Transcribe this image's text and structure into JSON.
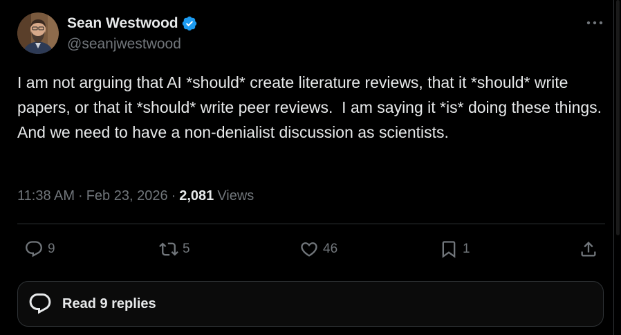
{
  "author": {
    "display_name": "Sean Westwood",
    "handle": "@seanjwestwood",
    "verified": true,
    "verified_color": "#1d9bf0",
    "avatar_icon": "profile-photo"
  },
  "post": {
    "text": "I am not arguing that AI *should* create literature reviews, that it *should* write papers, or that it *should* write peer reviews.  I am saying it *is* doing these things.  And we need to have a non-denialist discussion as scientists.",
    "time": "11:38 AM",
    "date": "Feb 23, 2026",
    "views_count": "2,081",
    "views_label": "Views"
  },
  "actions": {
    "reply": {
      "icon": "reply-icon",
      "count": "9"
    },
    "repost": {
      "icon": "repost-icon",
      "count": "5"
    },
    "like": {
      "icon": "heart-icon",
      "count": "46"
    },
    "bookmark": {
      "icon": "bookmark-icon",
      "count": "1"
    },
    "share": {
      "icon": "share-icon"
    }
  },
  "replies_button": {
    "label": "Read 9 replies",
    "icon": "chat-bubble-icon"
  },
  "colors": {
    "background": "#000000",
    "text_primary": "#e7e9ea",
    "text_secondary": "#71767b",
    "border": "#2f3336"
  }
}
